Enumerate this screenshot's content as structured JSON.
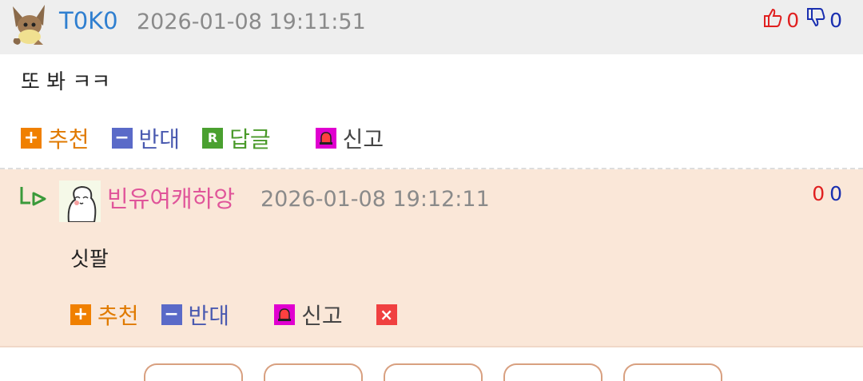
{
  "comment": {
    "author": "T0K0",
    "date": "2026-01-08 19:11:51",
    "up_count": "0",
    "down_count": "0",
    "body": "또 봐 ㅋㅋ",
    "actions": {
      "recommend": "추천",
      "oppose": "반대",
      "reply": "답글",
      "reply_icon": "R",
      "report": "신고"
    }
  },
  "reply": {
    "author": "빈유여캐하앙",
    "date": "2026-01-08 19:12:11",
    "up_count": "0",
    "down_count": "0",
    "body": "싯팔",
    "actions": {
      "recommend": "추천",
      "oppose": "반대",
      "report": "신고",
      "delete_icon": "×"
    }
  },
  "colors": {
    "author": "#2f7fd0",
    "reply_author": "#e0559a",
    "reply_bg": "#fae7d8",
    "header_bg": "#eeeeee"
  }
}
